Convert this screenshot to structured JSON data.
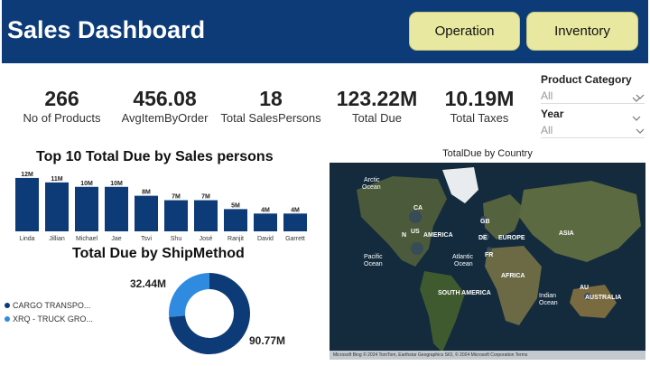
{
  "header": {
    "title": "Sales Dashboard",
    "nav": [
      "Operation",
      "Inventory"
    ]
  },
  "kpis": [
    {
      "value": "266",
      "label": "No of Products"
    },
    {
      "value": "456.08",
      "label": "AvgItemByOrder"
    },
    {
      "value": "18",
      "label": "Total SalesPersons"
    },
    {
      "value": "123.22M",
      "label": "Total Due"
    },
    {
      "value": "10.19M",
      "label": "Total Taxes"
    }
  ],
  "slicers": [
    {
      "label": "Product Category",
      "value": "All"
    },
    {
      "label": "Year",
      "value": "All"
    }
  ],
  "chart_data": [
    {
      "type": "bar",
      "title": "Top 10 Total Due by Sales persons",
      "categories": [
        "Linda",
        "Jillian",
        "Michael",
        "Jae",
        "Tsvi",
        "Shu",
        "José",
        "Ranjit",
        "David",
        "Garrett"
      ],
      "values": [
        12,
        11,
        10,
        10,
        8,
        7,
        7,
        5,
        4,
        4
      ],
      "data_labels": [
        "12M",
        "11M",
        "10M",
        "10M",
        "8M",
        "7M",
        "7M",
        "5M",
        "4M",
        "4M"
      ],
      "ylim": [
        0,
        13
      ],
      "color": "#0d3b78"
    },
    {
      "type": "pie",
      "title": "Total Due by ShipMethod",
      "categories": [
        "CARGO TRANSPO...",
        "XRQ - TRUCK GRO..."
      ],
      "values": [
        90.77,
        32.44
      ],
      "data_labels": [
        "90.77M",
        "32.44M"
      ],
      "colors": [
        "#0d3b78",
        "#2f8be0"
      ]
    }
  ],
  "map": {
    "title": "TotalDue by Country",
    "labels": {
      "arctic": "Arctic",
      "ocean": "Ocean",
      "ca": "CA",
      "us": "US",
      "north": "N",
      "america": "AMERICA",
      "gb": "GB",
      "de": "DE",
      "europe": "EUROPE",
      "fr": "FR",
      "asia": "ASIA",
      "pacific": "Pacific",
      "atlantic": "Atlantic",
      "africa": "AFRICA",
      "south_america": "SOUTH AMERICA",
      "indian": "Indian",
      "au": "AU",
      "australia": "AUSTRALIA"
    },
    "footer": "Microsoft Bing   © 2024 TomTom, Earthstar Geographics SIO, © 2024 Microsoft Corporation   Terms"
  },
  "icons": {
    "chevron": "chevron-down-icon"
  }
}
